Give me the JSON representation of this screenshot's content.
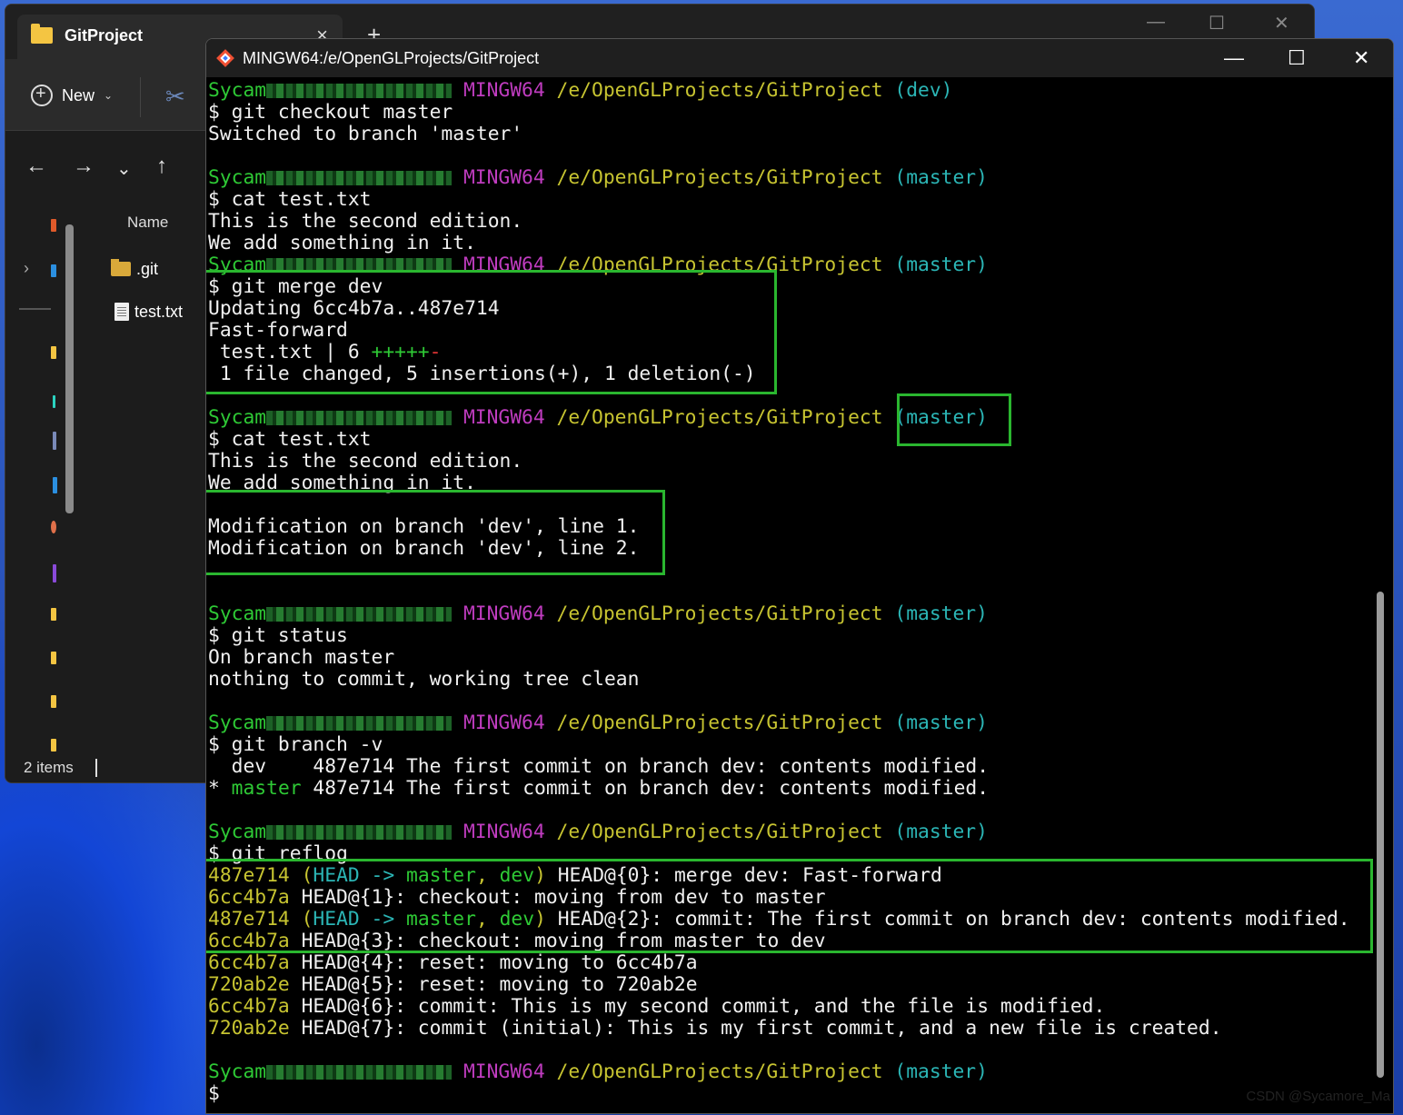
{
  "explorer": {
    "tab_title": "GitProject",
    "tab_close": "×",
    "new_tab": "+",
    "controls": {
      "minimize": "—",
      "maximize": "☐",
      "close": "✕"
    },
    "toolbar": {
      "new_label": "New",
      "new_chevron": "⌄"
    },
    "nav": {
      "back": "←",
      "forward": "→",
      "recent": "⌄",
      "up": "↑"
    },
    "column_name": "Name",
    "files": [
      {
        "name": ".git",
        "type": "folder"
      },
      {
        "name": "test.txt",
        "type": "file"
      }
    ],
    "status": "2 items"
  },
  "terminal": {
    "title": "MINGW64:/e/OpenGLProjects/GitProject",
    "controls": {
      "minimize": "—",
      "maximize": "☐",
      "close": "✕"
    },
    "colors": {
      "green": "#2ec935",
      "magenta": "#bf3cbf",
      "yellow": "#c7c431",
      "cyan": "#2bb5b5",
      "red": "#e03434",
      "highlight": "#2ab62f"
    },
    "prompt": {
      "user_prefix": "Sycam",
      "host": "MINGW64",
      "path": "/e/OpenGLProjects/GitProject"
    },
    "blocks": {
      "b1": {
        "branch": "(dev)",
        "cmd": "$ git checkout master",
        "out1": "Switched to branch 'master'"
      },
      "b2": {
        "branch": "(master)",
        "cmd": "$ cat test.txt",
        "out1": "This is the second edition.",
        "out2": "We add something in it."
      },
      "b3": {
        "branch": "(master)",
        "cmd": "$ git merge dev",
        "out1": "Updating 6cc4b7a..487e714",
        "out2": "Fast-forward",
        "stat_file": " test.txt | 6 ",
        "stat_plus": "+++++",
        "stat_minus": "-",
        "out4": " 1 file changed, 5 insertions(+), 1 deletion(-)"
      },
      "b4": {
        "branch": "(master)",
        "cmd": "$ cat test.txt",
        "out1": "This is the second edition.",
        "out2": "We add something in it.",
        "out3": "Modification on branch 'dev', line 1.",
        "out4": "Modification on branch 'dev', line 2."
      },
      "b5": {
        "branch": "(master)",
        "cmd": "$ git status",
        "out1": "On branch master",
        "out2": "nothing to commit, working tree clean"
      },
      "b6": {
        "branch": "(master)",
        "cmd": "$ git branch -v",
        "dev_line": "  dev    487e714 The first commit on branch dev: contents modified.",
        "star": "* ",
        "master_name": "master",
        "master_rest": " 487e714 The first commit on branch dev: contents modified."
      },
      "b7": {
        "branch": "(master)",
        "cmd": "$ git reflog"
      },
      "b8": {
        "branch": "(master)",
        "cmd": "$"
      }
    },
    "reflog": [
      {
        "hash": "487e714",
        "refs": true,
        "msg": " HEAD@{0}: merge dev: Fast-forward"
      },
      {
        "hash": "6cc4b7a",
        "refs": false,
        "msg": " HEAD@{1}: checkout: moving from dev to master"
      },
      {
        "hash": "487e714",
        "refs": true,
        "msg": " HEAD@{2}: commit: The first commit on branch dev: contents modified."
      },
      {
        "hash": "6cc4b7a",
        "refs": false,
        "msg": " HEAD@{3}: checkout: moving from master to dev"
      },
      {
        "hash": "6cc4b7a",
        "refs": false,
        "msg": " HEAD@{4}: reset: moving to 6cc4b7a"
      },
      {
        "hash": "720ab2e",
        "refs": false,
        "msg": " HEAD@{5}: reset: moving to 720ab2e"
      },
      {
        "hash": "6cc4b7a",
        "refs": false,
        "msg": " HEAD@{6}: commit: This is my second commit, and the file is modified."
      },
      {
        "hash": "720ab2e",
        "refs": false,
        "msg": " HEAD@{7}: commit (initial): This is my first commit, and a new file is created."
      }
    ],
    "refs_parts": {
      "open": " (",
      "head": "HEAD",
      "arrow": " -> ",
      "master": "master",
      "comma": ", ",
      "dev": "dev",
      "close": ")"
    }
  },
  "watermark": "CSDN @Sycamore_Ma"
}
